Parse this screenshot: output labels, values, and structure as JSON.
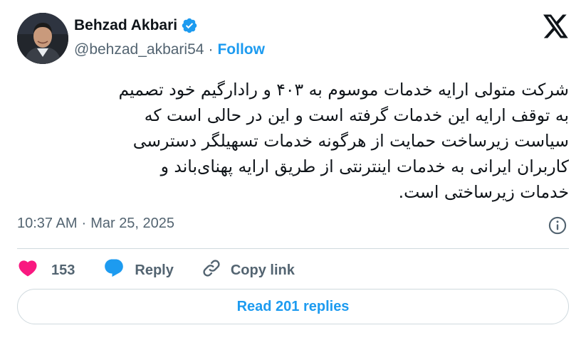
{
  "author": {
    "display_name": "Behzad Akbari",
    "handle": "@behzad_akbari54",
    "separator": "·",
    "follow_label": "Follow",
    "verified_icon": "verified-badge-icon",
    "verified_color": "#1d9bf0"
  },
  "tweet": {
    "text": "شرکت متولی ارایه خدمات موسوم به ۴۰۳ و رادارگیم خود تصمیم\nبه توقف ارایه این خدمات گرفته است و این در حالی است که\nسیاست زیرساخت حمایت از هرگونه خدمات تسهیلگر دسترسی\nکاربران ایرانی به خدمات اینترنتی از طریق ارایه پهنای‌باند و\nخدمات زیرساختی است.",
    "time": "10:37 AM",
    "separator": "·",
    "date": "Mar 25, 2025"
  },
  "actions": {
    "like_count": "153",
    "reply_label": "Reply",
    "copy_label": "Copy link",
    "like_color": "#f91880",
    "reply_color": "#1d9bf0"
  },
  "footer": {
    "read_replies_label": "Read 201 replies"
  },
  "colors": {
    "text_primary": "#0f1419",
    "text_secondary": "#536471",
    "accent": "#1d9bf0",
    "border": "#cfd9de"
  }
}
